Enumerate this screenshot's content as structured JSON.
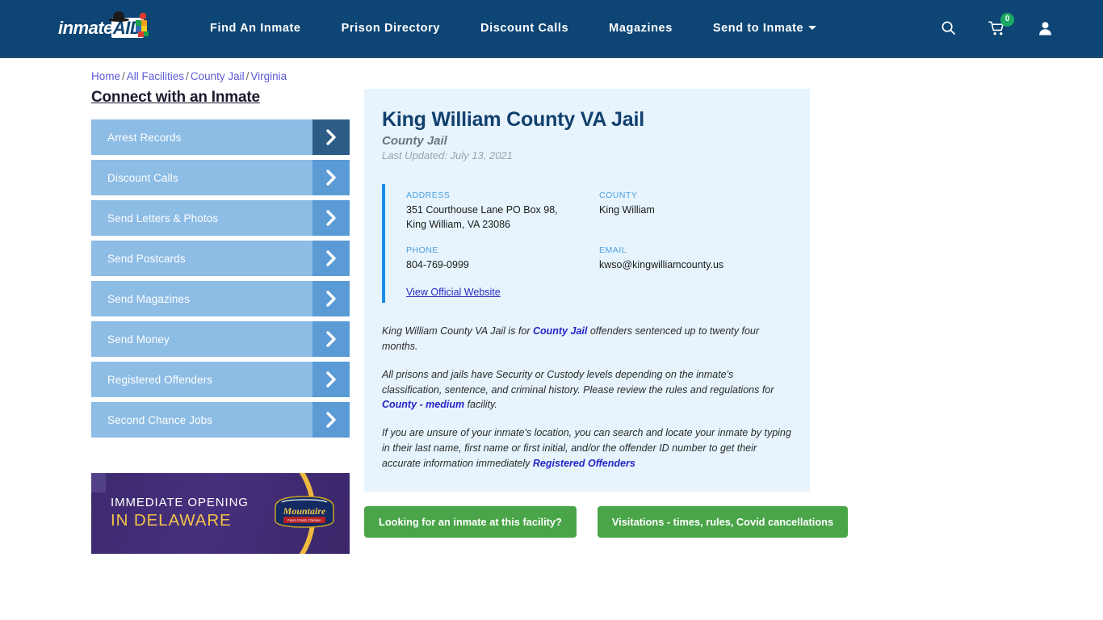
{
  "navbar": {
    "logo": {
      "text_part1": "inmate",
      "text_part2": "AID",
      "alt": "inmateaid-logo"
    },
    "links": [
      {
        "label": "Find An Inmate",
        "dropdown": false
      },
      {
        "label": "Prison Directory",
        "dropdown": false
      },
      {
        "label": "Discount Calls",
        "dropdown": false
      },
      {
        "label": "Magazines",
        "dropdown": false
      },
      {
        "label": "Send to Inmate",
        "dropdown": true
      }
    ],
    "icons": {
      "search": "search-icon",
      "cart": "cart-icon",
      "cart_count": "0",
      "account": "user-icon"
    },
    "colors": {
      "background": "#0d4574",
      "badge": "#1ba863"
    }
  },
  "breadcrumb": {
    "items": [
      "Home",
      "All Facilities",
      "County Jail",
      "Virginia"
    ],
    "separator": "/"
  },
  "sidebar": {
    "title": "Connect with an Inmate",
    "items": [
      {
        "label": "Arrest Records",
        "active": true
      },
      {
        "label": "Discount Calls",
        "active": false
      },
      {
        "label": "Send Letters & Photos",
        "active": false
      },
      {
        "label": "Send Postcards",
        "active": false
      },
      {
        "label": "Send Magazines",
        "active": false
      },
      {
        "label": "Send Money",
        "active": false
      },
      {
        "label": "Registered Offenders",
        "active": false
      },
      {
        "label": "Second Chance Jobs",
        "active": false
      }
    ]
  },
  "ad": {
    "line1": "IMMEDIATE OPENING",
    "line2": "IN DELAWARE",
    "brand": "Mountaire",
    "brand_sub": "Farm Fresh Chicken"
  },
  "facility": {
    "title": "King William County VA Jail",
    "subtitle": "County Jail",
    "last_updated": "Last Updated: July 13, 2021",
    "details": [
      {
        "label": "ADDRESS",
        "value": "351 Courthouse Lane PO Box 98, King William, VA 23086"
      },
      {
        "label": "COUNTY",
        "value": "King William"
      },
      {
        "label": "PHONE",
        "value": "804-769-0999"
      },
      {
        "label": "EMAIL",
        "value": "kwso@kingwilliamcounty.us"
      }
    ],
    "website_link": "View Official Website"
  },
  "description": {
    "p1_before": "King William County VA Jail is for ",
    "p1_link": "County Jail",
    "p1_after": " offenders sentenced up to twenty four months.",
    "p2_before": "All prisons and jails have Security or Custody levels depending on the inmate's classification, sentence, and criminal history. Please review the rules and regulations for ",
    "p2_link": "County - medium",
    "p2_after": " facility.",
    "p3_before": "If you are unsure of your inmate's location, you can search and locate your inmate by typing in their last name, first name or first initial, and/or the offender ID number to get their accurate information immediately ",
    "p3_link": "Registered Offenders",
    "p3_after": ""
  },
  "cta": {
    "button1": "Looking for an inmate at this facility?",
    "button2": "Visitations - times, rules, Covid cancellations",
    "color": "#4aa548"
  }
}
